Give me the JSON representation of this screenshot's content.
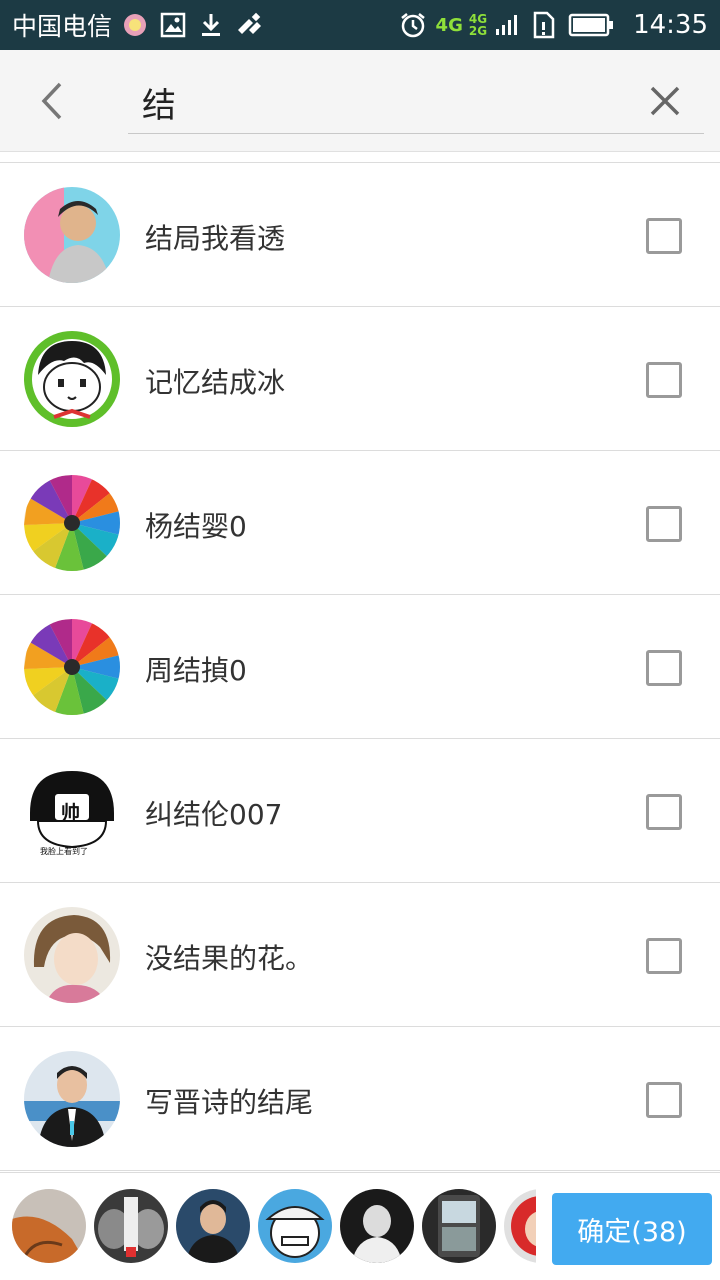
{
  "status_bar": {
    "carrier": "中国电信",
    "network": "4G",
    "network_secondary_top": "4G",
    "network_secondary_bottom": "2G",
    "time": "14:35",
    "icons": [
      "app-icon",
      "image-icon",
      "download-icon",
      "tools-icon",
      "alarm-icon",
      "signal-icon",
      "sim-icon",
      "battery-icon"
    ]
  },
  "search": {
    "value": "结",
    "back_icon": "chevron-left-icon",
    "clear_icon": "close-icon"
  },
  "contacts": [
    {
      "name": "结局我看透",
      "avatar": "photo-man-avatar",
      "checked": false
    },
    {
      "name": "记忆结成冰",
      "avatar": "cartoon-boy-avatar",
      "checked": false
    },
    {
      "name": "杨结婴0",
      "avatar": "color-pencils-avatar",
      "checked": false
    },
    {
      "name": "周结揁0",
      "avatar": "color-pencils-avatar",
      "checked": false
    },
    {
      "name": "纠结伦007",
      "avatar": "shuai-cartoon-avatar",
      "checked": false
    },
    {
      "name": "没结果的花。",
      "avatar": "photo-woman-avatar",
      "checked": false
    },
    {
      "name": "写晋诗的结尾",
      "avatar": "photo-suit-man-avatar",
      "checked": false
    }
  ],
  "shuai_avatar": {
    "badge": "帅",
    "caption": "我脸上看到了"
  },
  "bottom": {
    "selected_avatars": [
      "guitar-avatar",
      "poster-avatar",
      "photo-man-avatar",
      "cap-cartoon-avatar",
      "bw-photo-avatar",
      "phone-photo-avatar",
      "red-avatar"
    ],
    "confirm_label": "确定(38)"
  },
  "colors": {
    "status_bar_bg": "#1c3a44",
    "header_bg": "#f5f5f5",
    "accent": "#42aaf0",
    "network_green": "#8fe03a"
  }
}
